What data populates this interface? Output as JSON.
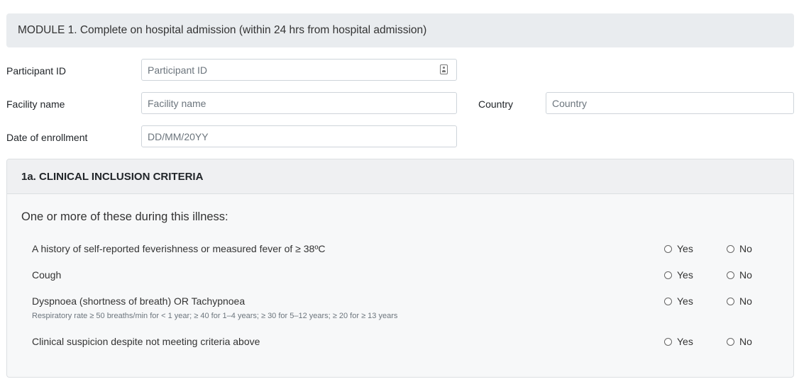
{
  "module": {
    "title": "MODULE 1. Complete on hospital admission (within 24 hrs from hospital admission)"
  },
  "fields": {
    "participant_id": {
      "label": "Participant ID",
      "placeholder": "Participant ID",
      "icon": "id-card-icon"
    },
    "facility_name": {
      "label": "Facility name",
      "placeholder": "Facility name"
    },
    "country": {
      "label": "Country",
      "placeholder": "Country"
    },
    "date_of_enrollment": {
      "label": "Date of enrollment",
      "placeholder": "DD/MM/20YY"
    }
  },
  "criteria": {
    "title": "1a. CLINICAL INCLUSION CRITERIA",
    "intro": "One or more of these during this illness:",
    "questions": [
      {
        "text": "A history of self-reported feverishness or measured fever of ≥ 38ºC",
        "note": "",
        "yes": "Yes",
        "no": "No"
      },
      {
        "text": "Cough",
        "note": "",
        "yes": "Yes",
        "no": "No"
      },
      {
        "text": "Dyspnoea (shortness of breath) OR Tachypnoea",
        "note": "Respiratory rate ≥ 50 breaths/min for < 1 year; ≥ 40 for 1–4 years; ≥ 30 for 5–12 years; ≥ 20 for ≥ 13 years",
        "yes": "Yes",
        "no": "No"
      },
      {
        "text": "Clinical suspicion despite not meeting criteria above",
        "note": "",
        "yes": "Yes",
        "no": "No"
      }
    ]
  }
}
